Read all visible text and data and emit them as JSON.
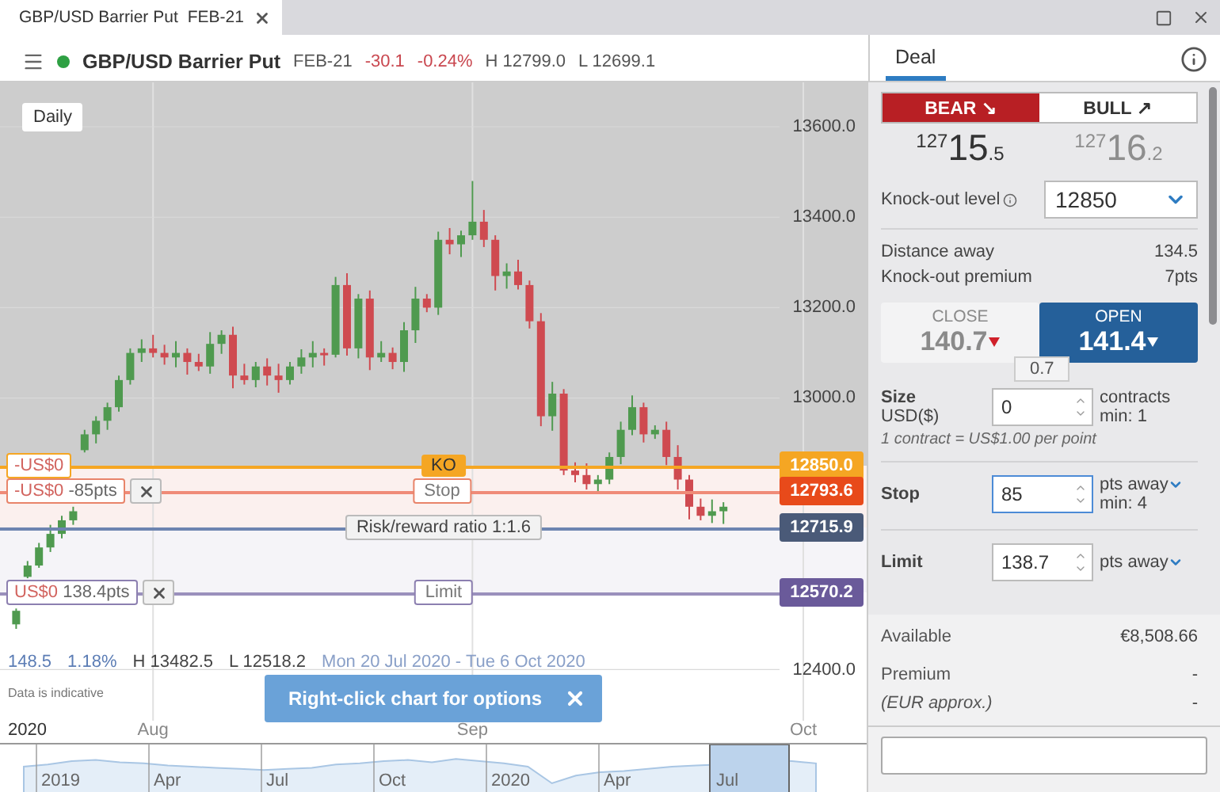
{
  "tab": {
    "title": "GBP/USD Barrier Put",
    "expiry": "FEB-21"
  },
  "header": {
    "market_open": true,
    "title": "GBP/USD Barrier Put",
    "expiry": "FEB-21",
    "change": "-30.1",
    "change_pct": "-0.24%",
    "high": "H 12799.0",
    "low": "L 12699.1"
  },
  "chart": {
    "interval": "Daily",
    "chart_data": {
      "type": "candlestick",
      "grid": true,
      "categories": [
        null,
        null,
        null,
        null,
        null,
        null,
        null,
        null,
        null,
        null,
        null,
        null,
        "Aug",
        null,
        null,
        null,
        null,
        null,
        null,
        null,
        null,
        null,
        null,
        null,
        null,
        null,
        null,
        null,
        null,
        null,
        null,
        null,
        null,
        null,
        null,
        null,
        null,
        null,
        null,
        null,
        "Sep",
        null,
        null,
        null,
        null,
        null,
        null,
        null,
        null,
        null,
        null,
        null,
        null,
        null,
        null,
        null,
        null,
        null,
        null,
        null,
        null,
        null,
        null,
        null,
        null,
        null,
        null,
        null,
        null,
        "Oct"
      ],
      "ohlc": [
        [
          12500,
          12535,
          12490,
          12530
        ],
        [
          12605,
          12640,
          12602,
          12630
        ],
        [
          12630,
          12680,
          12625,
          12670
        ],
        [
          12670,
          12720,
          12660,
          12700
        ],
        [
          12700,
          12740,
          12690,
          12730
        ],
        [
          12730,
          12760,
          12720,
          12750
        ],
        [
          12885,
          12930,
          12880,
          12920
        ],
        [
          12920,
          12960,
          12900,
          12950
        ],
        [
          12950,
          12990,
          12930,
          12980
        ],
        [
          12980,
          13050,
          12970,
          13040
        ],
        [
          13040,
          13110,
          13030,
          13100
        ],
        [
          13100,
          13130,
          13080,
          13110
        ],
        [
          13110,
          13140,
          13090,
          13100
        ],
        [
          13100,
          13118,
          13074,
          13090
        ],
        [
          13090,
          13126,
          13068,
          13100
        ],
        [
          13100,
          13110,
          13052,
          13080
        ],
        [
          13080,
          13098,
          13060,
          13070
        ],
        [
          13070,
          13146,
          13054,
          13120
        ],
        [
          13120,
          13150,
          13098,
          13140
        ],
        [
          13140,
          13158,
          13022,
          13050
        ],
        [
          13050,
          13076,
          13030,
          13040
        ],
        [
          13040,
          13080,
          13024,
          13070
        ],
        [
          13070,
          13088,
          13028,
          13050
        ],
        [
          13050,
          13076,
          13012,
          13040
        ],
        [
          13040,
          13080,
          13030,
          13070
        ],
        [
          13070,
          13108,
          13054,
          13090
        ],
        [
          13090,
          13126,
          13068,
          13100
        ],
        [
          13100,
          13110,
          13072,
          13096
        ],
        [
          13096,
          13268,
          13090,
          13250
        ],
        [
          13250,
          13276,
          13094,
          13110
        ],
        [
          13110,
          13230,
          13088,
          13220
        ],
        [
          13220,
          13238,
          13062,
          13090
        ],
        [
          13090,
          13126,
          13080,
          13100
        ],
        [
          13100,
          13112,
          13064,
          13080
        ],
        [
          13080,
          13168,
          13058,
          13150
        ],
        [
          13150,
          13246,
          13122,
          13220
        ],
        [
          13220,
          13230,
          13190,
          13200
        ],
        [
          13200,
          13368,
          13184,
          13350
        ],
        [
          13350,
          13376,
          13318,
          13340
        ],
        [
          13340,
          13370,
          13312,
          13360
        ],
        [
          13360,
          13480,
          13350,
          13390
        ],
        [
          13390,
          13416,
          13334,
          13350
        ],
        [
          13350,
          13360,
          13238,
          13270
        ],
        [
          13270,
          13298,
          13242,
          13280
        ],
        [
          13280,
          13306,
          13240,
          13250
        ],
        [
          13250,
          13260,
          13154,
          13170
        ],
        [
          13170,
          13188,
          12938,
          12960
        ],
        [
          12960,
          13036,
          12928,
          13010
        ],
        [
          13010,
          13020,
          12830,
          12840
        ],
        [
          12840,
          12858,
          12814,
          12830
        ],
        [
          12830,
          12856,
          12798,
          12810
        ],
        [
          12810,
          12830,
          12792,
          12820
        ],
        [
          12820,
          12880,
          12810,
          12870
        ],
        [
          12870,
          12948,
          12854,
          12930
        ],
        [
          12930,
          13006,
          12918,
          12980
        ],
        [
          12980,
          12990,
          12902,
          12920
        ],
        [
          12920,
          12940,
          12910,
          12930
        ],
        [
          12930,
          12948,
          12852,
          12870
        ],
        [
          12870,
          12896,
          12798,
          12820
        ],
        [
          12820,
          12830,
          12732,
          12760
        ],
        [
          12760,
          12778,
          12730,
          12740
        ],
        [
          12740,
          12776,
          12724,
          12750
        ],
        [
          12750,
          12770,
          12722,
          12760
        ],
        null,
        null,
        null,
        null,
        null,
        null,
        null
      ],
      "ylim": [
        12287,
        13698
      ],
      "yticks": [
        {
          "value": 13600,
          "label": "13600.0"
        },
        {
          "value": 13400,
          "label": "13400.0"
        },
        {
          "value": 13200,
          "label": "13200.0"
        },
        {
          "value": 13000,
          "label": "13000.0"
        },
        {
          "value": 12400,
          "label": "12400.0"
        }
      ]
    },
    "x_axis_year": "2020",
    "levels": [
      {
        "kind": "ko",
        "pnl": "-US$0",
        "tag": "KO",
        "price": "12850.0"
      },
      {
        "kind": "stop",
        "pnl": "-US$0",
        "distance": "-85pts",
        "tag": "Stop",
        "price": "12793.6"
      },
      {
        "kind": "current",
        "tag": "Risk/reward ratio 1:1.6",
        "price": "12715.9"
      },
      {
        "kind": "limit",
        "pnl": "US$0",
        "distance": "138.4pts",
        "tag": "Limit",
        "price": "12570.2"
      }
    ],
    "stats": {
      "change": "148.5",
      "change_pct": "1.18%",
      "high": "H 13482.5",
      "low": "L 12518.2",
      "range": "Mon 20 Jul 2020 - Tue 6 Oct 2020"
    },
    "note": "Data is indicative",
    "navigator": [
      "2019",
      "Apr",
      "Jul",
      "Oct",
      "2020",
      "Apr",
      "Jul"
    ]
  },
  "toast": {
    "text": "Right-click chart for options"
  },
  "deal": {
    "tab": "Deal",
    "sides": [
      {
        "label": "BEAR ↘",
        "selected": true,
        "big": "127",
        "main": "15",
        "small": ".5"
      },
      {
        "label": "BULL ↗",
        "selected": false,
        "big": "127",
        "main": "16",
        "small": ".2"
      }
    ],
    "knockout": {
      "label": "Knock-out level",
      "value": "12850"
    },
    "info_rows": [
      {
        "label": "Distance away",
        "value": "134.5"
      },
      {
        "label": "Knock-out premium",
        "value": "7pts"
      }
    ],
    "trade_buttons": [
      {
        "label": "CLOSE",
        "value": "140.7",
        "selected": false
      },
      {
        "label": "OPEN",
        "value": "141.4",
        "selected": true
      }
    ],
    "spread": "0.7",
    "size": {
      "label": "Size",
      "unit": "USD($)",
      "value": "0",
      "note": "contracts",
      "min": "min: 1",
      "hint": "1 contract = US$1.00 per point"
    },
    "stop": {
      "label": "Stop",
      "value": "85",
      "focused": true,
      "unit": "pts away",
      "min": "min: 4"
    },
    "limit": {
      "label": "Limit",
      "value": "138.7",
      "focused": false,
      "unit": "pts away"
    },
    "summary": [
      {
        "kind": "plain",
        "label": "Available",
        "value": "€8,508.66"
      },
      {
        "kind": "plain",
        "label": "Premium",
        "value": "-"
      },
      {
        "kind": "note",
        "label": "(EUR approx.)",
        "value": "-"
      }
    ]
  }
}
